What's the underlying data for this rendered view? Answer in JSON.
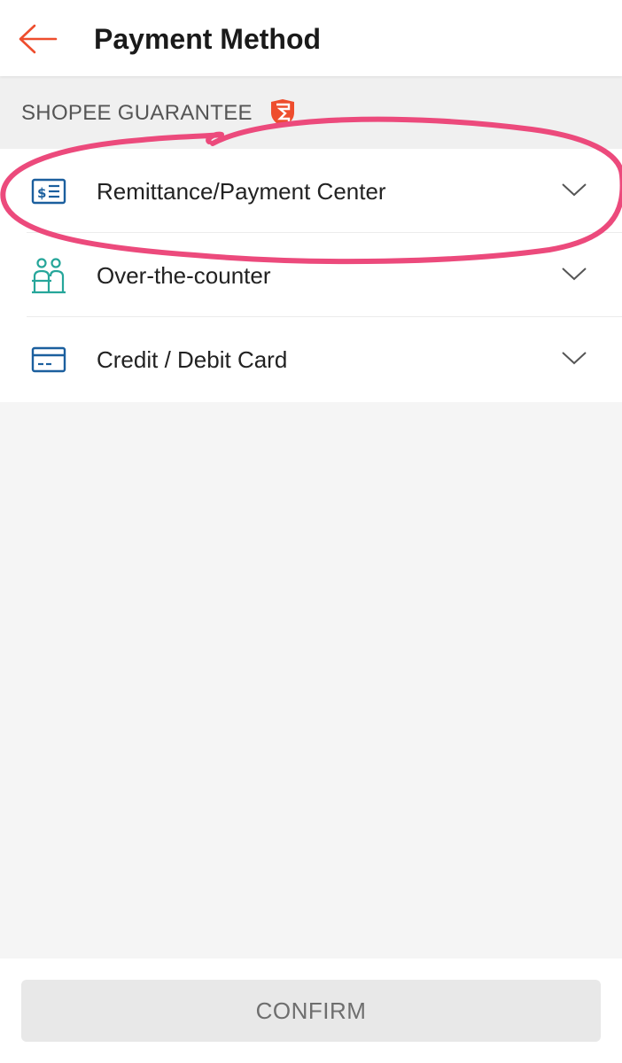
{
  "header": {
    "title": "Payment Method",
    "back_icon": "arrow-left-icon"
  },
  "guarantee": {
    "label": "SHOPEE GUARANTEE",
    "icon": "shield-icon"
  },
  "methods": [
    {
      "label": "Remittance/Payment Center",
      "icon": "remittance-icon"
    },
    {
      "label": "Over-the-counter",
      "icon": "counter-people-icon"
    },
    {
      "label": "Credit / Debit Card",
      "icon": "credit-card-icon"
    }
  ],
  "footer": {
    "confirm_label": "CONFIRM"
  },
  "colors": {
    "accent": "#ee4d2d",
    "annotation": "#ec4a7c",
    "icon_blue": "#1b5f9e",
    "icon_teal": "#26a69a",
    "button_disabled": "#e8e8e8"
  }
}
